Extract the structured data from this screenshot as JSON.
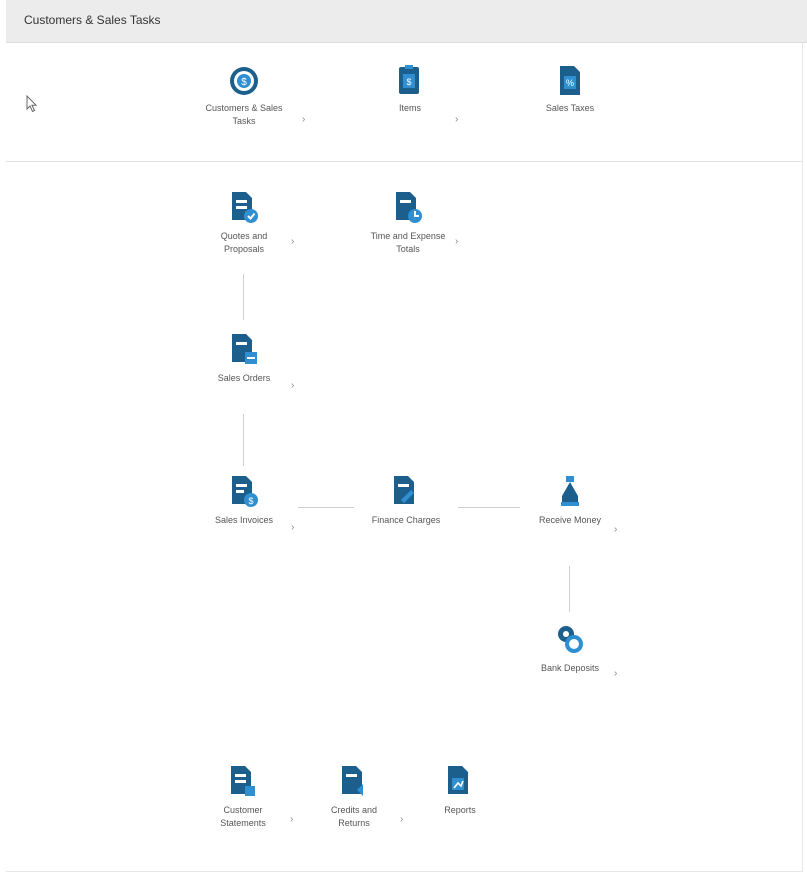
{
  "window": {
    "title": "Customers & Sales Tasks"
  },
  "top_items": [
    {
      "label": "Customers & Sales Tasks"
    },
    {
      "label": "Items"
    },
    {
      "label": "Sales Taxes"
    }
  ],
  "flow_items": [
    {
      "label": "Quotes and Proposals"
    },
    {
      "label": "Time and Expense Totals"
    },
    {
      "label": "Sales Orders"
    },
    {
      "label": "Sales Invoices"
    },
    {
      "label": "Finance Charges"
    },
    {
      "label": "Receive Money"
    },
    {
      "label": "Bank Deposits"
    }
  ],
  "bottom_items": [
    {
      "label": "Customer Statements"
    },
    {
      "label": "Credits and Returns"
    },
    {
      "label": "Reports"
    }
  ],
  "arrow_glyph": "›",
  "colors": {
    "icon_dark": "#1c5f8c",
    "icon_light": "#2f8fd0",
    "line": "#cfcfcf"
  }
}
